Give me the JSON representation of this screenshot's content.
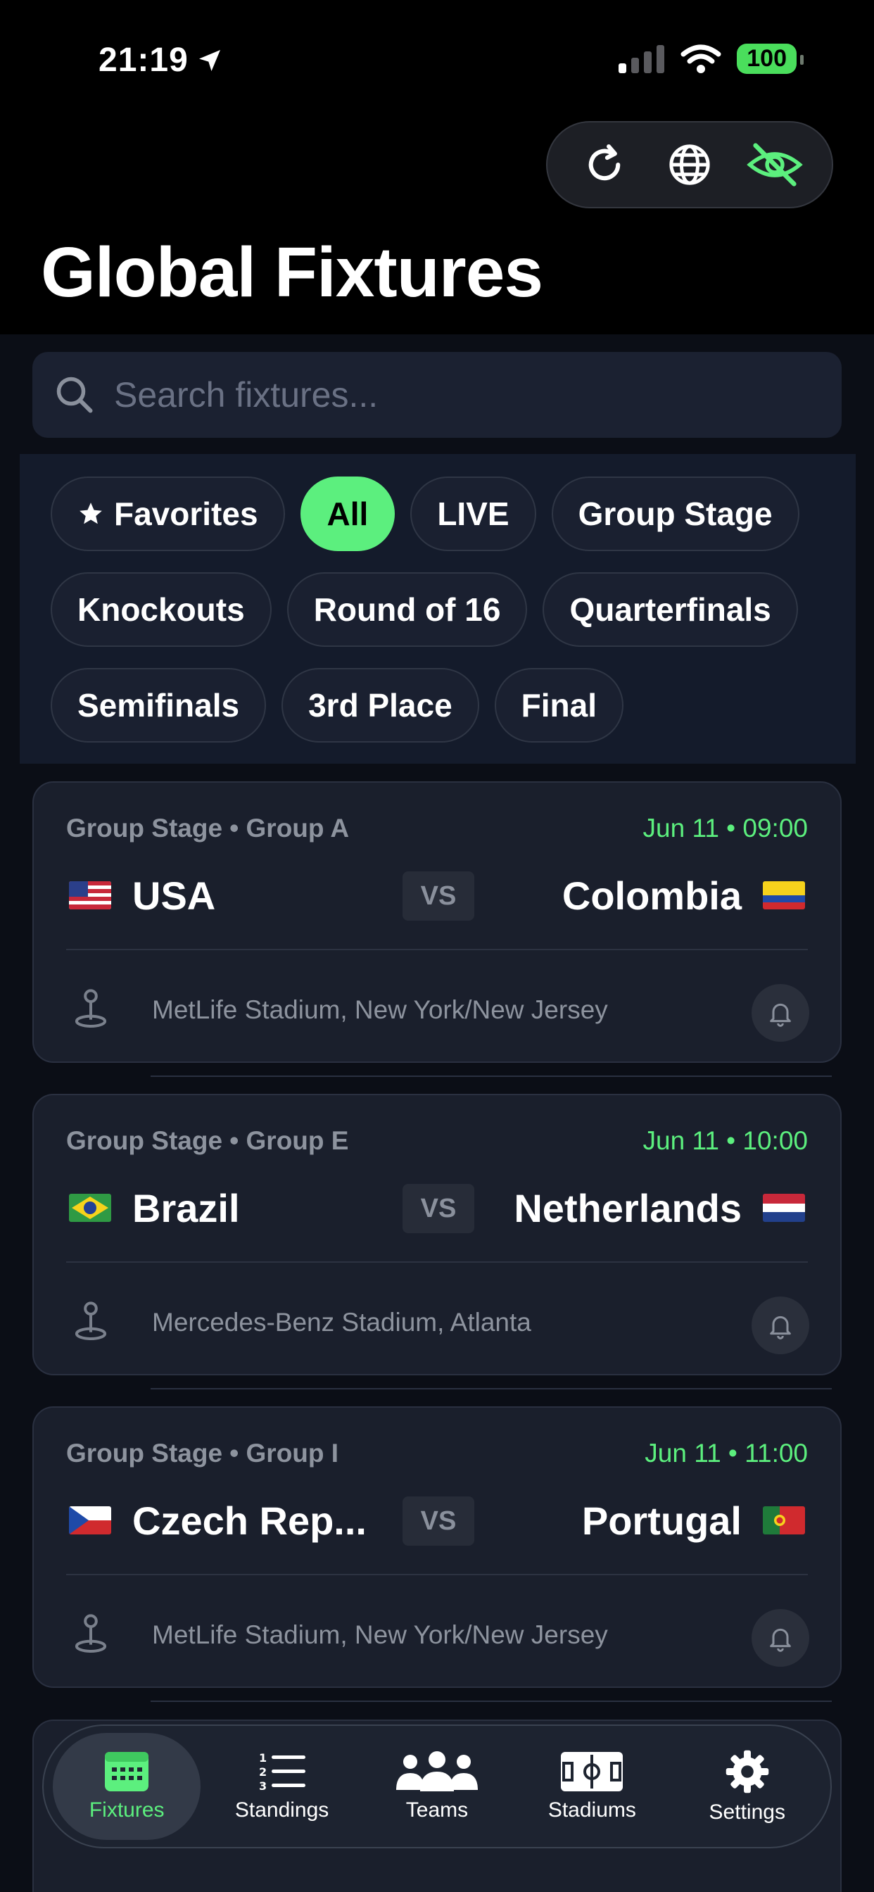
{
  "status": {
    "time": "21:19",
    "battery": "100"
  },
  "header": {
    "title": "Global Fixtures"
  },
  "search": {
    "placeholder": "Search fixtures..."
  },
  "filters": {
    "favorites": "Favorites",
    "all": "All",
    "live": "LIVE",
    "group_stage": "Group Stage",
    "knockouts": "Knockouts",
    "round_of_16": "Round of 16",
    "quarterfinals": "Quarterfinals",
    "semifinals": "Semifinals",
    "third_place": "3rd Place",
    "final": "Final",
    "active": "All"
  },
  "fixtures": [
    {
      "stage": "Group Stage • Group A",
      "datetime": "Jun 11 • 09:00",
      "home": "USA",
      "away": "Colombia",
      "vs": "VS",
      "venue": "MetLife Stadium, New York/New Jersey"
    },
    {
      "stage": "Group Stage • Group E",
      "datetime": "Jun 11 • 10:00",
      "home": "Brazil",
      "away": "Netherlands",
      "vs": "VS",
      "venue": "Mercedes-Benz Stadium, Atlanta"
    },
    {
      "stage": "Group Stage • Group I",
      "datetime": "Jun 11 • 11:00",
      "home": "Czech Rep...",
      "away": "Portugal",
      "vs": "VS",
      "venue": "MetLife Stadium, New York/New Jersey"
    }
  ],
  "tabs": {
    "fixtures": "Fixtures",
    "standings": "Standings",
    "teams": "Teams",
    "stadiums": "Stadiums",
    "settings": "Settings",
    "active": "Fixtures"
  },
  "colors": {
    "accent": "#5cef7e",
    "background": "#0b0e16",
    "card": "#1a1f2c"
  }
}
